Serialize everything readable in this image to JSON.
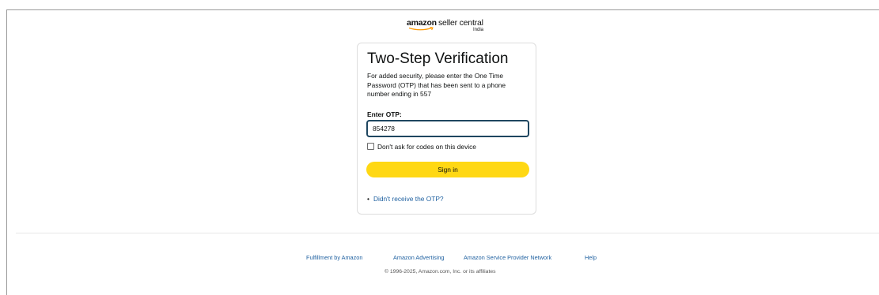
{
  "logo": {
    "brand": "amazon",
    "product": "seller central",
    "region": "India"
  },
  "verification": {
    "title": "Two-Step Verification",
    "description": "For added security, please enter the One Time Password (OTP) that has been sent to a phone number ending in 557",
    "otp_label": "Enter OTP:",
    "otp_value": "854278",
    "remember_label": "Don't ask for codes on this device",
    "remember_checked": false,
    "signin_label": "Sign in",
    "resend_link": "Didn't receive the OTP?"
  },
  "footer": {
    "links": [
      "Fulfillment by Amazon",
      "Amazon Advertising",
      "Amazon Service Provider Network",
      "Help"
    ],
    "copyright": "© 1996-2025, Amazon.com, Inc. or its affiliates"
  },
  "colors": {
    "button_yellow": "#ffd814",
    "link_blue": "#2162a1",
    "input_focus_border": "#1e4660",
    "smile_orange": "#ff9900"
  },
  "icons": {
    "logo_smile": "amazon-smile-arrow"
  }
}
